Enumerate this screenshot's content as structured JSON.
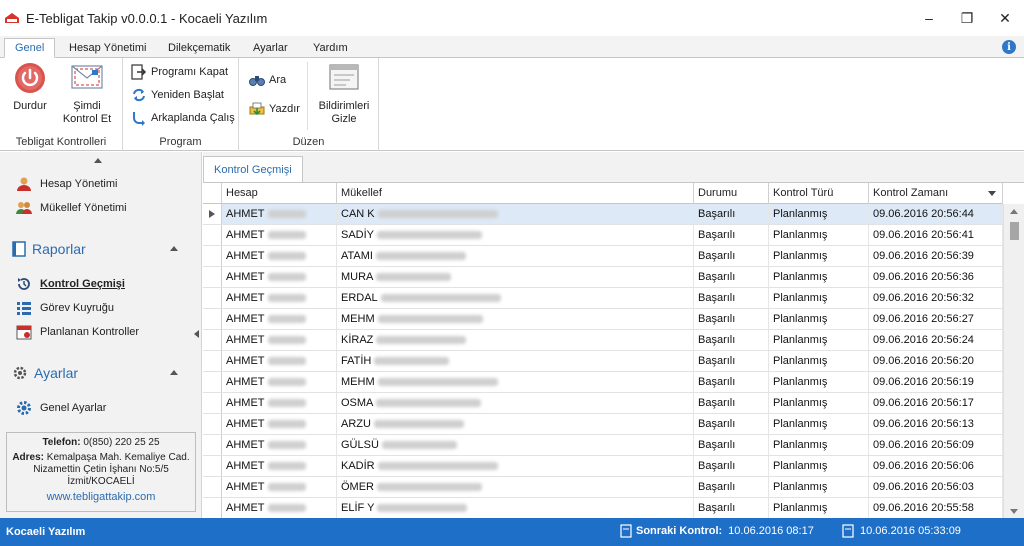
{
  "window": {
    "title": "E-Tebligat Takip v0.0.0.1 - Kocaeli Yazılım",
    "minimize": "–",
    "restore": "❐",
    "close": "✕"
  },
  "ribbon": {
    "tabs": [
      "Genel",
      "Hesap Yönetimi",
      "Dilekçematik",
      "Ayarlar",
      "Yardım"
    ],
    "groups": {
      "tebligat": {
        "label": "Tebligat Kontrolleri",
        "stop": "Durdur",
        "check_now_1": "Şimdi",
        "check_now_2": "Kontrol Et"
      },
      "program": {
        "label": "Program",
        "close": "Programı Kapat",
        "restart": "Yeniden Başlat",
        "background": "Arkaplanda Çalış"
      },
      "duzen": {
        "label": "Düzen",
        "search": "Ara",
        "print": "Yazdır",
        "hide_1": "Bildirimleri",
        "hide_2": "Gizle"
      }
    }
  },
  "sidebar": {
    "items_top": [
      "Hesap Yönetimi",
      "Mükellef Yönetimi"
    ],
    "reports_header": "Raporlar",
    "reports": [
      "Kontrol Geçmişi",
      "Görev Kuyruğu",
      "Planlanan Kontroller"
    ],
    "settings_header": "Ayarlar",
    "settings": [
      "Genel Ayarlar"
    ],
    "contact": {
      "phone_label": "Telefon:",
      "phone": "0(850) 220 25 25",
      "address_label": "Adres:",
      "address_1": "Kemalpaşa Mah. Kemaliye Cad.",
      "address_2": "Nizamettin Çetin İşhanı No:5/5",
      "address_3": "İzmit/KOCAELİ",
      "website": "www.tebligattakip.com"
    }
  },
  "content": {
    "tab": "Kontrol Geçmişi",
    "columns": [
      "Hesap",
      "Mükellef",
      "Durumu",
      "Kontrol Türü",
      "Kontrol Zamanı"
    ],
    "rows": [
      {
        "hesap": "AHMET",
        "mukellef": "CAN K",
        "durum": "Başarılı",
        "tur": "Planlanmış",
        "zaman": "09.06.2016 20:56:44"
      },
      {
        "hesap": "AHMET",
        "mukellef": "SADİY",
        "durum": "Başarılı",
        "tur": "Planlanmış",
        "zaman": "09.06.2016 20:56:41"
      },
      {
        "hesap": "AHMET",
        "mukellef": "ATAMI",
        "durum": "Başarılı",
        "tur": "Planlanmış",
        "zaman": "09.06.2016 20:56:39"
      },
      {
        "hesap": "AHMET",
        "mukellef": "MURA",
        "durum": "Başarılı",
        "tur": "Planlanmış",
        "zaman": "09.06.2016 20:56:36"
      },
      {
        "hesap": "AHMET",
        "mukellef": "ERDAL",
        "durum": "Başarılı",
        "tur": "Planlanmış",
        "zaman": "09.06.2016 20:56:32"
      },
      {
        "hesap": "AHMET",
        "mukellef": "MEHM",
        "durum": "Başarılı",
        "tur": "Planlanmış",
        "zaman": "09.06.2016 20:56:27"
      },
      {
        "hesap": "AHMET",
        "mukellef": "KİRAZ",
        "durum": "Başarılı",
        "tur": "Planlanmış",
        "zaman": "09.06.2016 20:56:24"
      },
      {
        "hesap": "AHMET",
        "mukellef": "FATİH",
        "durum": "Başarılı",
        "tur": "Planlanmış",
        "zaman": "09.06.2016 20:56:20"
      },
      {
        "hesap": "AHMET",
        "mukellef": "MEHM",
        "durum": "Başarılı",
        "tur": "Planlanmış",
        "zaman": "09.06.2016 20:56:19"
      },
      {
        "hesap": "AHMET",
        "mukellef": "OSMA",
        "durum": "Başarılı",
        "tur": "Planlanmış",
        "zaman": "09.06.2016 20:56:17"
      },
      {
        "hesap": "AHMET",
        "mukellef": "ARZU",
        "durum": "Başarılı",
        "tur": "Planlanmış",
        "zaman": "09.06.2016 20:56:13"
      },
      {
        "hesap": "AHMET",
        "mukellef": "GÜLSÜ",
        "durum": "Başarılı",
        "tur": "Planlanmış",
        "zaman": "09.06.2016 20:56:09"
      },
      {
        "hesap": "AHMET",
        "mukellef": "KADİR",
        "durum": "Başarılı",
        "tur": "Planlanmış",
        "zaman": "09.06.2016 20:56:06"
      },
      {
        "hesap": "AHMET",
        "mukellef": "ÖMER",
        "durum": "Başarılı",
        "tur": "Planlanmış",
        "zaman": "09.06.2016 20:56:03"
      },
      {
        "hesap": "AHMET",
        "mukellef": "ELİF Y",
        "durum": "Başarılı",
        "tur": "Planlanmış",
        "zaman": "09.06.2016 20:55:58"
      }
    ]
  },
  "status": {
    "company": "Kocaeli Yazılım",
    "next_label": "Sonraki Kontrol:",
    "next_value": "10.06.2016 08:17",
    "now_value": "10.06.2016 05:33:09"
  },
  "colors": {
    "accent": "#2b6cb0",
    "statusbar": "#1e6fc8",
    "selected_row": "#dde9f7"
  }
}
